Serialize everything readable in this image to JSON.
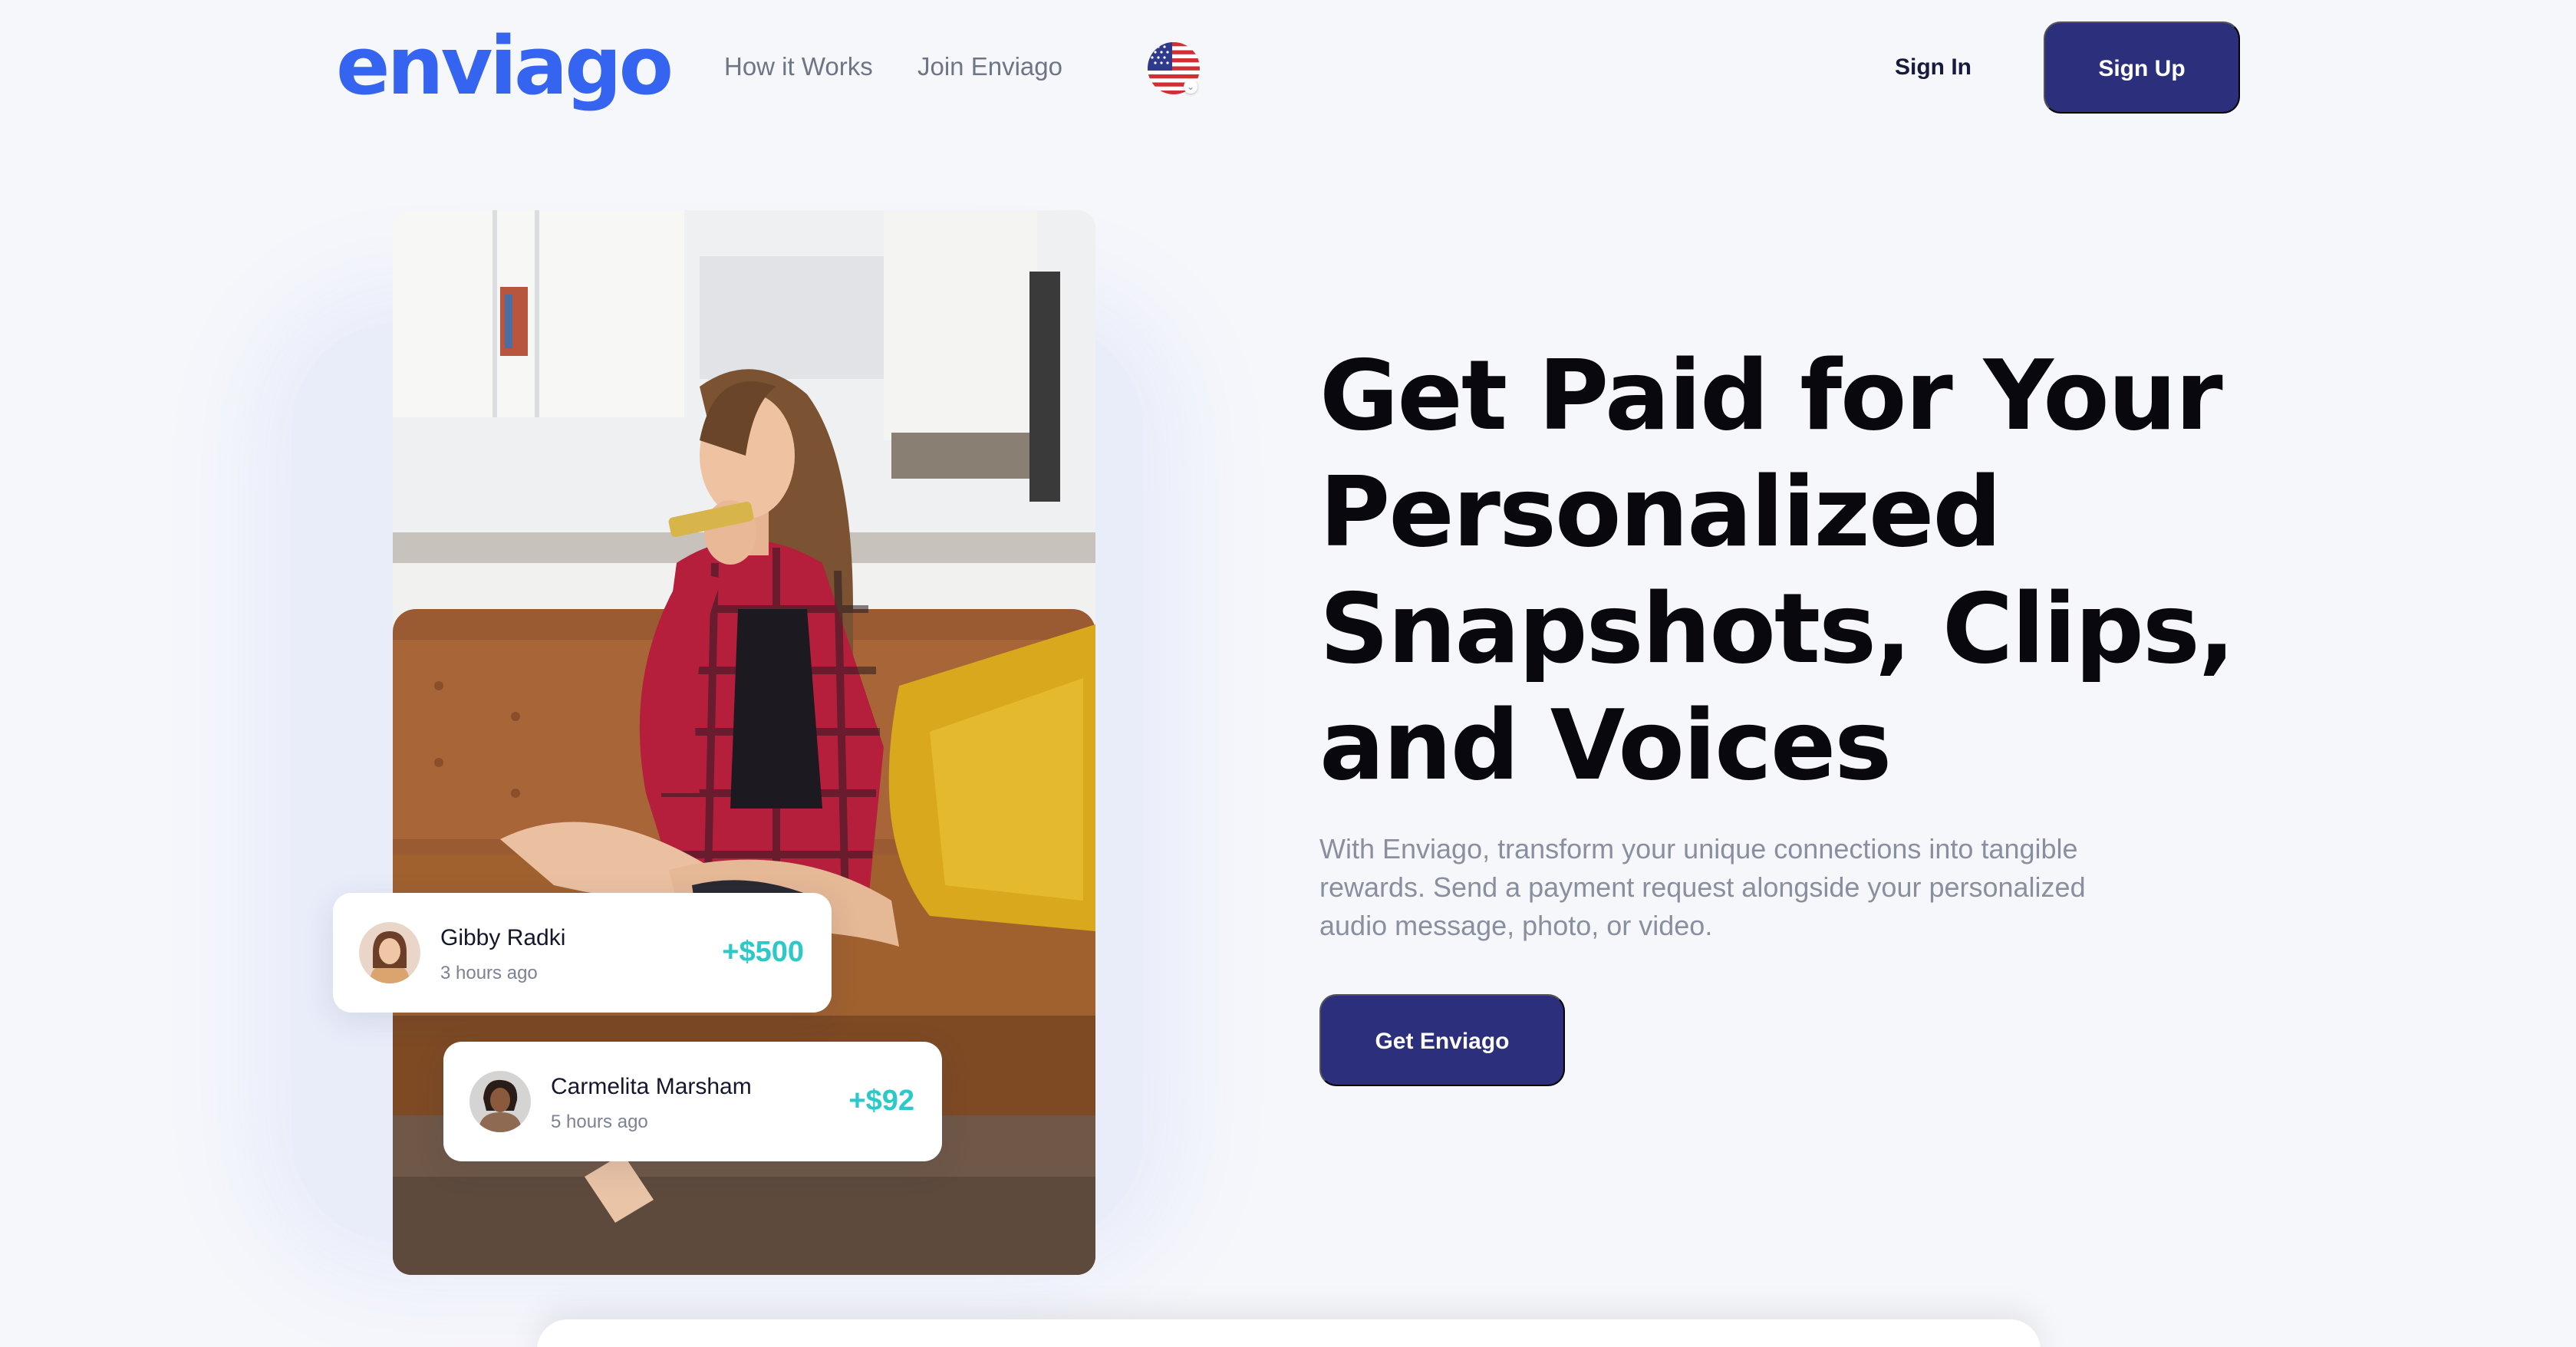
{
  "header": {
    "logo": "enviago",
    "nav": [
      {
        "label": "How it Works"
      },
      {
        "label": "Join Enviago"
      }
    ],
    "language_icon": "us-flag-icon",
    "sign_in": "Sign In",
    "sign_up": "Sign Up"
  },
  "hero": {
    "headline": "Get Paid for Your Personalized Snapshots, Clips, and Voices",
    "subtext": "With Enviago, transform your unique connections into tangible rewards. Send a payment request alongside your personalized audio message, photo, or video.",
    "cta": "Get Enviago",
    "payments": [
      {
        "name": "Gibby Radki",
        "time": "3 hours ago",
        "amount": "+$500"
      },
      {
        "name": "Carmelita Marsham",
        "time": "5 hours ago",
        "amount": "+$92"
      }
    ]
  },
  "colors": {
    "brand_blue": "#3564f0",
    "button_navy": "#2b2f7c",
    "amount_teal": "#2dc8c8",
    "background": "#f6f7fb"
  }
}
